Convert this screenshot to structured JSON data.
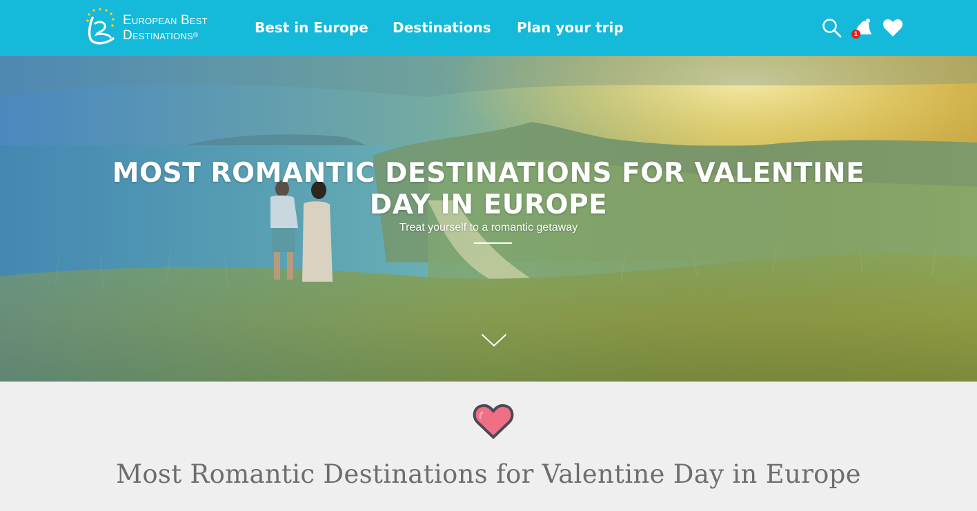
{
  "header": {
    "logo": {
      "line1": "European Best",
      "line2": "Destinations",
      "registered": "®",
      "icon": "ebd-logo-icon"
    },
    "nav_links": [
      {
        "label": "Best in Europe"
      },
      {
        "label": "Destinations"
      },
      {
        "label": "Plan your trip"
      }
    ],
    "icons": {
      "search": "search-icon",
      "notifications": "bell-icon",
      "favorites": "heart-icon"
    },
    "notification_count": "1",
    "colors": {
      "bar": "#15b9d9",
      "badge": "#e41d1d"
    }
  },
  "hero": {
    "title": "MOST ROMANTIC DESTINATIONS FOR VALENTINE DAY IN EUROPE",
    "subtitle": "Treat yourself to a romantic getaway",
    "scroll_icon": "chevron-down-icon"
  },
  "content": {
    "heart_icon": "heart-icon",
    "heart_colors": {
      "fill": "#ef6f84",
      "stroke": "#4b4a55"
    },
    "title": "Most Romantic Destinations for Valentine Day in Europe"
  }
}
